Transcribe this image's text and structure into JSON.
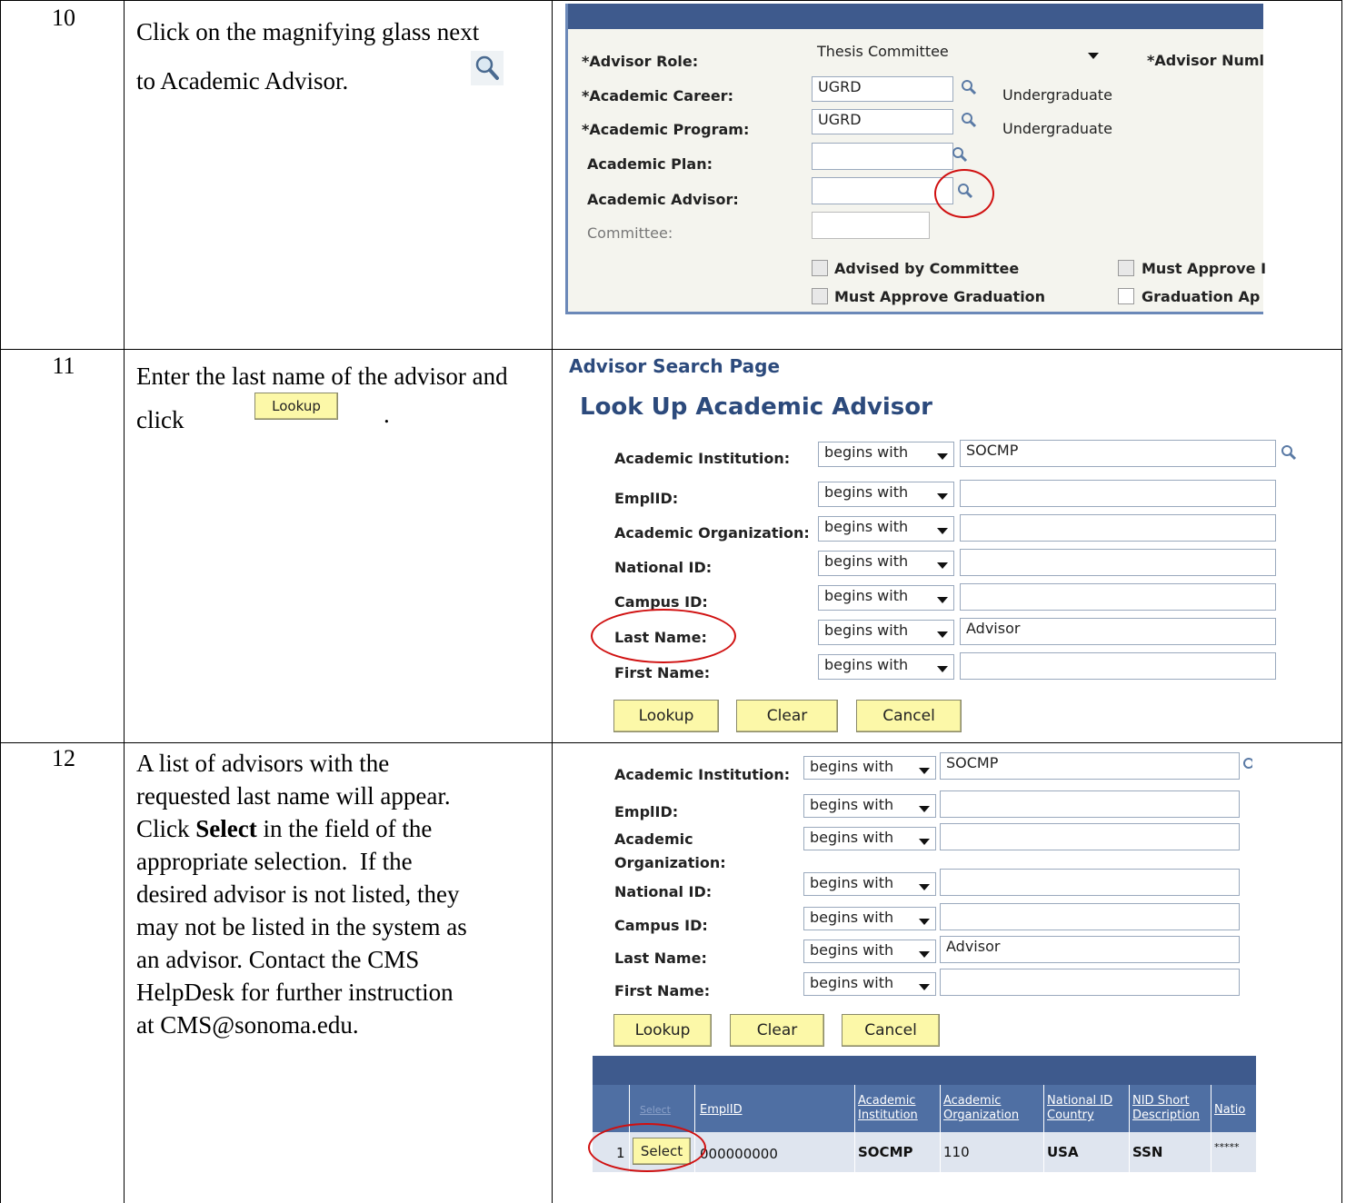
{
  "steps": [
    {
      "number": "10",
      "instruction": "Click on the magnifying glass next to Academic Advisor."
    },
    {
      "number": "11",
      "instruction_before": "Enter the last name of the advisor and click",
      "instruction_button": "Lookup",
      "instruction_after": "."
    },
    {
      "number": "12",
      "instruction_lines": [
        "A list of advisors with the",
        "requested last name will appear.",
        "Click ",
        "Select",
        " in the field of the",
        "appropriate selection.  If the",
        "desired advisor is not listed, they",
        "may not be listed in the system as",
        "an advisor. Contact the CMS",
        "HelpDesk for further instruction",
        "at CMS@sonoma.edu."
      ]
    }
  ],
  "advisor_form": {
    "advisor_role_label": "*Advisor Role:",
    "advisor_role_value": "Thesis Committee",
    "advisor_number_label": "*Advisor Numl",
    "academic_career_label": "*Academic Career:",
    "academic_career_value": "UGRD",
    "academic_career_desc": "Undergraduate",
    "academic_program_label": "*Academic Program:",
    "academic_program_value": "UGRD",
    "academic_program_desc": "Undergraduate",
    "academic_plan_label": "Academic Plan:",
    "academic_advisor_label": "Academic Advisor:",
    "committee_label": "Committee:",
    "advised_by_committee_label": "Advised by Committee",
    "must_approve_label": "Must Approve I",
    "must_approve_graduation_label": "Must Approve Graduation",
    "graduation_app_label": "Graduation Ap"
  },
  "lookup_page": {
    "page_name": "Advisor Search Page",
    "heading": "Look Up Academic Advisor",
    "operator": "begins with",
    "fields": [
      {
        "label": "Academic Institution:",
        "value": "SOCMP"
      },
      {
        "label": "EmplID:",
        "value": ""
      },
      {
        "label": "Academic Organization:",
        "value": ""
      },
      {
        "label": "National ID:",
        "value": ""
      },
      {
        "label": "Campus ID:",
        "value": ""
      },
      {
        "label": "Last Name:",
        "value": "Advisor"
      },
      {
        "label": "First Name:",
        "value": ""
      }
    ],
    "buttons": {
      "lookup": "Lookup",
      "clear": "Clear",
      "cancel": "Cancel"
    }
  },
  "results_page": {
    "operator": "begins with",
    "fields": [
      {
        "label": "Academic Institution:",
        "value": "SOCMP"
      },
      {
        "label": "EmplID:",
        "value": ""
      },
      {
        "label_line1": "Academic",
        "label_line2": "Organization:",
        "value": ""
      },
      {
        "label": "National ID:",
        "value": ""
      },
      {
        "label": "Campus ID:",
        "value": ""
      },
      {
        "label": "Last Name:",
        "value": "Advisor"
      },
      {
        "label": "First Name:",
        "value": ""
      }
    ],
    "buttons": {
      "lookup": "Lookup",
      "clear": "Clear",
      "cancel": "Cancel"
    },
    "table": {
      "headers": {
        "select": "Select",
        "emplid": "EmplID",
        "institution_1": "Academic",
        "institution_2": "Institution",
        "organization_1": "Academic",
        "organization_2": "Organization",
        "country_1": "National ID",
        "country_2": "Country",
        "nid_1": "NID Short",
        "nid_2": "Description",
        "national": "Natio"
      },
      "row": {
        "index": "1",
        "select": "Select",
        "emplid": "000000000",
        "institution": "SOCMP",
        "organization": "110",
        "country": "USA",
        "nid": "SSN",
        "national": "*****"
      }
    }
  }
}
